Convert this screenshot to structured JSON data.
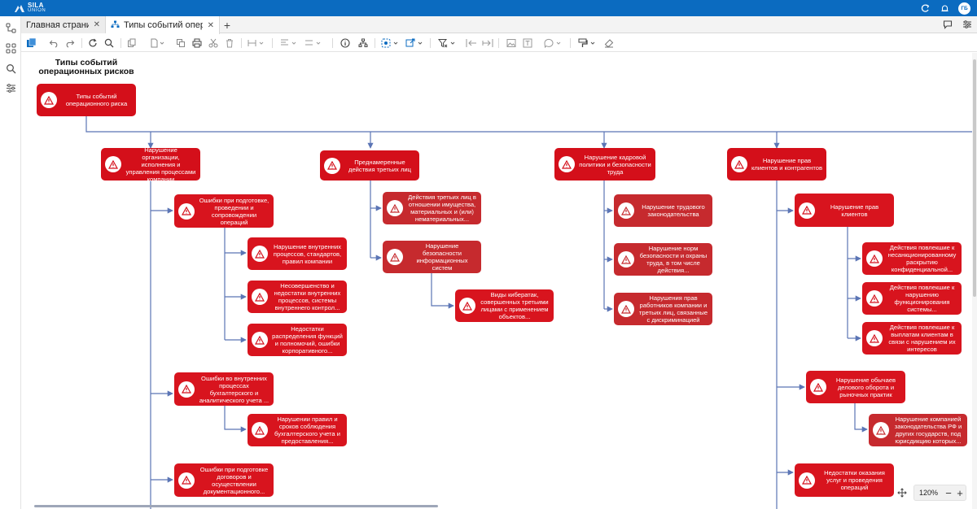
{
  "app": {
    "brand_top": "SILA",
    "brand_bottom": "UNION",
    "user_initials": "ГБ"
  },
  "tabs": [
    {
      "label": "Главная страница",
      "active": false
    },
    {
      "label": "Типы событий операц",
      "active": true
    }
  ],
  "toolbar": {
    "icons": [
      "save-icon",
      "undo-icon",
      "redo-icon",
      "refresh-icon",
      "search-icon",
      "copy-icon",
      "page-icon",
      "duplicate-icon",
      "print-icon",
      "cut-icon",
      "delete-icon",
      "resize-icon",
      "align-icon",
      "distribute-icon",
      "info-icon",
      "hierarchy-icon",
      "select-icon",
      "export-icon",
      "filter-icon",
      "collapse-left-icon",
      "expand-right-icon",
      "image-icon",
      "text-icon",
      "comment-icon",
      "format-icon",
      "eraser-icon"
    ]
  },
  "canvas": {
    "title": "Типы событий операционных рисков",
    "nodes": {
      "root": "Типы событий операционного риска",
      "c1": "Нарушение организации, исполнения и управления процессами компании",
      "c2": "Преднамеренные действия третьих лиц",
      "c3": "Нарушение кадровой политики и безопасности труда",
      "c4": "Нарушение прав клиентов и контрагентов",
      "c1a": "Ошибки при подготовке, проведении и сопровождении операций",
      "c1a1": "Нарушение внутренних процессов, стандартов, правил компании",
      "c1a2": "Несовершенство и недостатки внутренних процессов, системы внутреннего контрол...",
      "c1a3": "Недостатки распределения функций и полномочий, ошибки корпоративного...",
      "c1b": "Ошибки во внутренних процессах бухгалтерского и аналитического учета ...",
      "c1b1": "Нарушении правил и сроков соблюдения бухгалтерского учета и предоставления...",
      "c1c": "Ошибки при подготовке договоров и осуществлении документационного...",
      "c2a": "Действия третьих лиц в отношении имущества, материальных и (или) нематериальных...",
      "c2b": "Нарушение безопасности информационных систем",
      "c2b1": "Виды кибератак, совершенных третьими лицами с применением объектов...",
      "c3a": "Нарушение трудового законодательства",
      "c3b": "Нарушение норм безопасности и охраны труда, в том числе действия...",
      "c3c": "Нарушения прав работников компании и третьих лиц, связанные с дискриминацией",
      "c4a": "Нарушение прав клиентов",
      "c4a1": "Действия повлекшие к несанкционированному раскрытию конфиденциальной...",
      "c4a2": "Действия повлекшие к нарушению функционирования системы...",
      "c4a3": "Действия повлекшие к выплатам клиентам в связи с нарушением их интересов",
      "c4b": "Нарушение обычаев делового оборота и рыночных практик",
      "c4b1": "Нарушение компанией законодательства РФ и других государств, под юрисдикцию которых...",
      "c4c": "Недостатки оказания услуг и проведения операций"
    }
  },
  "zoom": {
    "value": "120%",
    "minus": "−",
    "plus": "+"
  },
  "colors": {
    "brand": "#0b6bc0",
    "node_primary": "#d40f1a",
    "node_secondary": "#c62a2e",
    "connector": "#5b75b5"
  }
}
